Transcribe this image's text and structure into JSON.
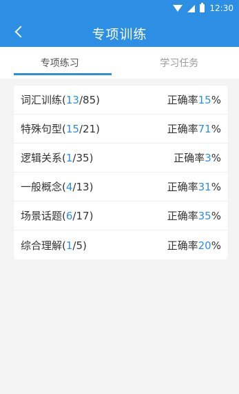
{
  "status_bar": {
    "time": "12:30"
  },
  "header": {
    "title": "专项训练"
  },
  "tabs": [
    {
      "label": "专项练习",
      "active": true
    },
    {
      "label": "学习任务",
      "active": false
    }
  ],
  "accuracy_label": "正确率",
  "items": [
    {
      "name": "词汇训练",
      "done": "13",
      "total": "85",
      "accuracy": "15"
    },
    {
      "name": "特殊句型",
      "done": "15",
      "total": "21",
      "accuracy": "71"
    },
    {
      "name": "逻辑关系",
      "done": "1",
      "total": "35",
      "accuracy": "3"
    },
    {
      "name": "一般概念",
      "done": "4",
      "total": "13",
      "accuracy": "31"
    },
    {
      "name": "场景话题",
      "done": "6",
      "total": "17",
      "accuracy": "35"
    },
    {
      "name": "综合理解",
      "done": "1",
      "total": "5",
      "accuracy": "20"
    }
  ],
  "colors": {
    "accent": "#2c8fe3",
    "background": "#f4f4f4"
  }
}
